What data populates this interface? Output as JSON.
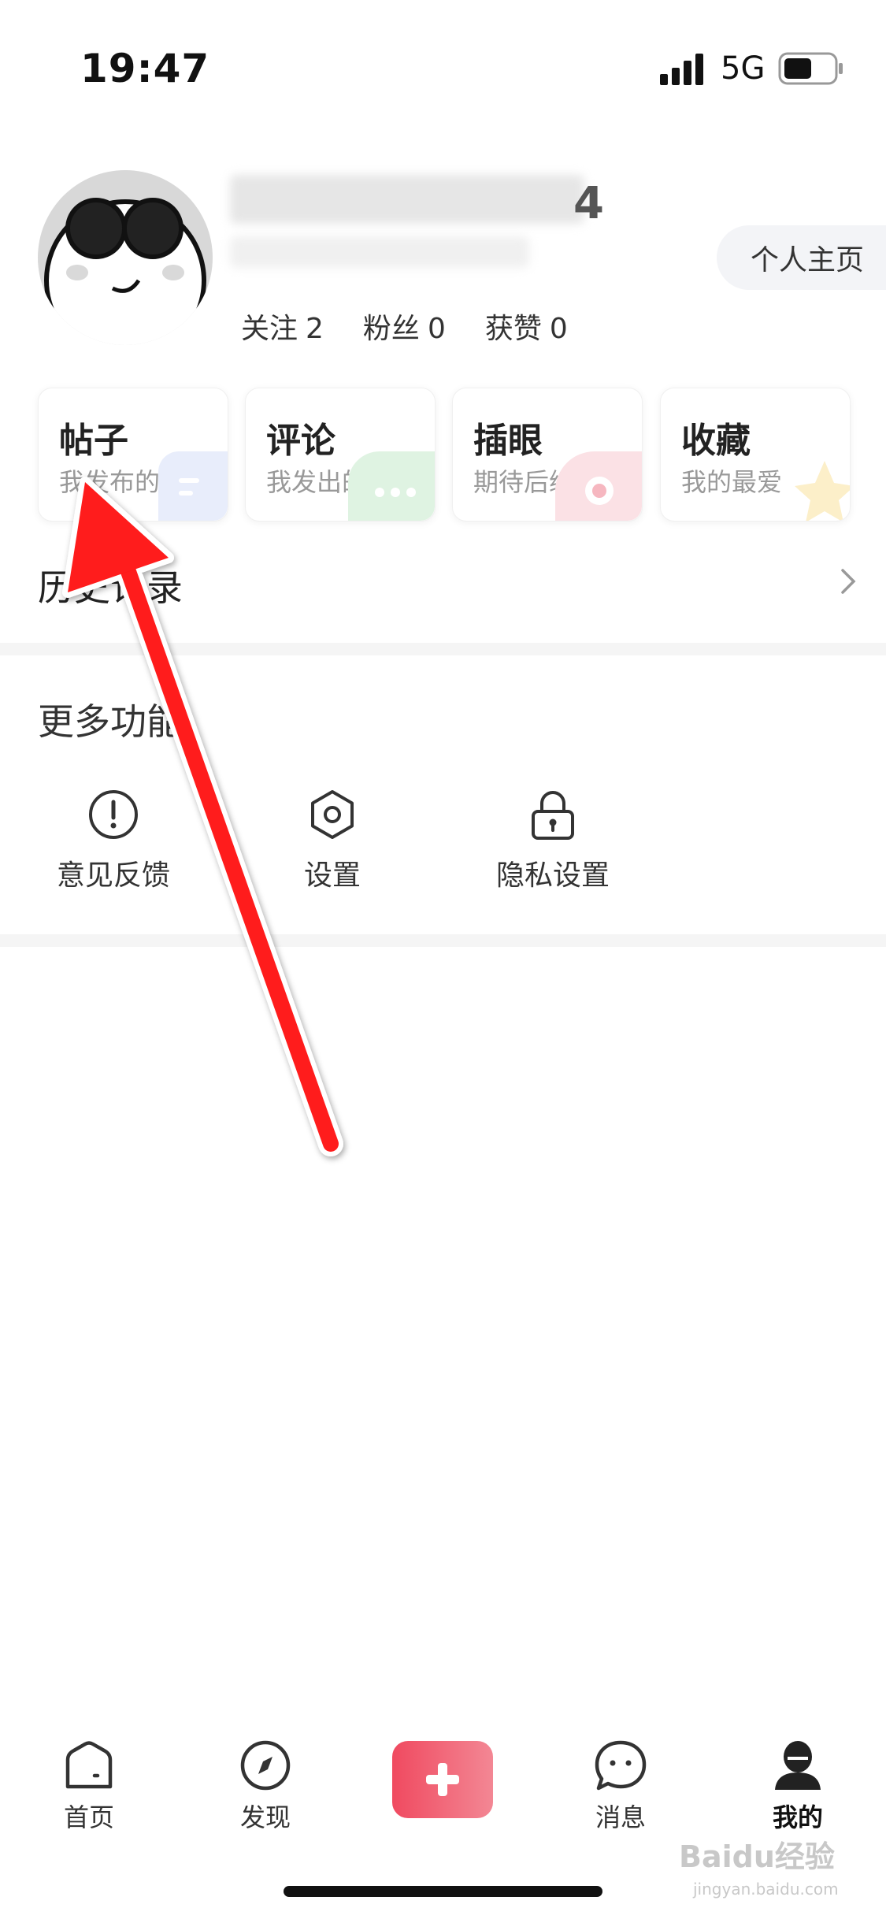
{
  "status_bar": {
    "time": "19:47",
    "network": "5G"
  },
  "profile": {
    "name_suffix": "4",
    "home_button": "个人主页",
    "stats": [
      {
        "label": "关注",
        "value": "2"
      },
      {
        "label": "粉丝",
        "value": "0"
      },
      {
        "label": "获赞",
        "value": "0"
      }
    ]
  },
  "cards": [
    {
      "title": "帖子",
      "subtitle": "我发布的",
      "color": "#e8edfb"
    },
    {
      "title": "评论",
      "subtitle": "我发出的",
      "color": "#e5f6e8"
    },
    {
      "title": "插眼",
      "subtitle": "期待后续",
      "color": "#fbe4e7"
    },
    {
      "title": "收藏",
      "subtitle": "我的最爱",
      "color": "#fdf3d9"
    }
  ],
  "history": {
    "label": "历史记录"
  },
  "more": {
    "title": "更多功能",
    "items": [
      {
        "label": "意见反馈",
        "icon": "exclamation-circle-icon"
      },
      {
        "label": "设置",
        "icon": "hexagon-gear-icon"
      },
      {
        "label": "隐私设置",
        "icon": "lock-icon"
      }
    ]
  },
  "tabbar": {
    "items": [
      {
        "label": "首页",
        "icon": "home-icon"
      },
      {
        "label": "发现",
        "icon": "compass-icon"
      },
      {
        "label": "消息",
        "icon": "chat-icon"
      },
      {
        "label": "我的",
        "icon": "user-icon"
      }
    ],
    "plus_icon": "plus-icon",
    "accent": "#f04a60"
  },
  "watermark": {
    "logo": "Baidu经验",
    "url": "jingyan.baidu.com"
  },
  "annotation": {
    "arrow_color": "#ff1a1a"
  }
}
